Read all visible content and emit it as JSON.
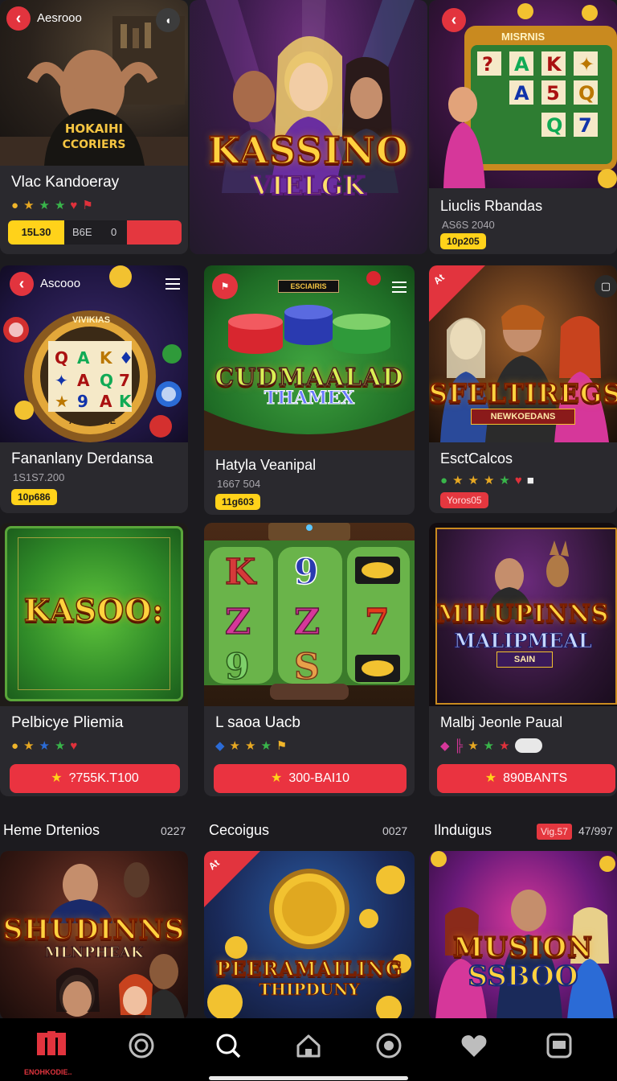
{
  "cards": [
    {
      "header": "Aesrooo",
      "title": "Vlac Kandoeray",
      "chip": "15L30",
      "meta_b": "B6E",
      "meta_c": "0"
    },
    {
      "logo": "KASSINO",
      "sublogo": "VIELGK"
    },
    {
      "header_logo": "MISRNIS",
      "title": "Liuclis Rbandas",
      "meta": "AS6S 2040",
      "chip": "10p205"
    },
    {
      "header": "Ascooo",
      "wheel_label": "VIVIKIAS",
      "wheel_sub": "AROUS CE",
      "title": "Fananlany Derdansa",
      "meta": "1S1S7.200",
      "chip": "10p686"
    },
    {
      "banner": "ESCIAIRIS",
      "logo": "CUDMAALAD",
      "sublogo": "THAMEX",
      "title": "Hatyla Veanipal",
      "meta": "1667 504",
      "chip": "11g603"
    },
    {
      "corner": "At",
      "logo": "SFELTIREGS",
      "sublogo": "NEWKOEDANS",
      "title": "EsctCalcos",
      "chip": "Yoros05"
    },
    {
      "logo": "KASOO:",
      "title": "Pelbicye Pliemia",
      "cta": "?755K.T100"
    },
    {
      "reels": [
        "K",
        "9",
        "Z",
        "Z",
        "7",
        "9",
        "S"
      ],
      "title": "L saoa Uacb",
      "cta": "300-BAI10"
    },
    {
      "logo": "MILUPINNS",
      "sublogo": "MALIPMEAL",
      "plate": "SAIN",
      "title": "Malbj Jeonle Paual",
      "cta": "890BANTS"
    },
    {
      "logo": "SHUDINNS",
      "sublogo": "MLNPHEAK"
    },
    {
      "corner": "At",
      "logo": "PEERAMAILING",
      "sublogo": "THIPDUNY"
    },
    {
      "logo": "MUSION",
      "sublogo": "SSBOO"
    }
  ],
  "sections": [
    {
      "title": "Heme Drtenios",
      "count": "0227"
    },
    {
      "title": "Cecoigus",
      "count": "0027"
    },
    {
      "title": "Ilnduigus",
      "badge": "Vig.57",
      "count": "47/997"
    }
  ],
  "nav": {
    "brand_label": "ENOHKODIE..",
    "items": [
      "brand-icon",
      "target-icon",
      "search-icon",
      "home-icon",
      "target-icon",
      "heart-icon",
      "square-icon"
    ]
  },
  "colors": {
    "background": "#1c1b1f",
    "card": "#2a292e",
    "accent_red": "#ea3340",
    "accent_yellow": "#ffd21a"
  }
}
